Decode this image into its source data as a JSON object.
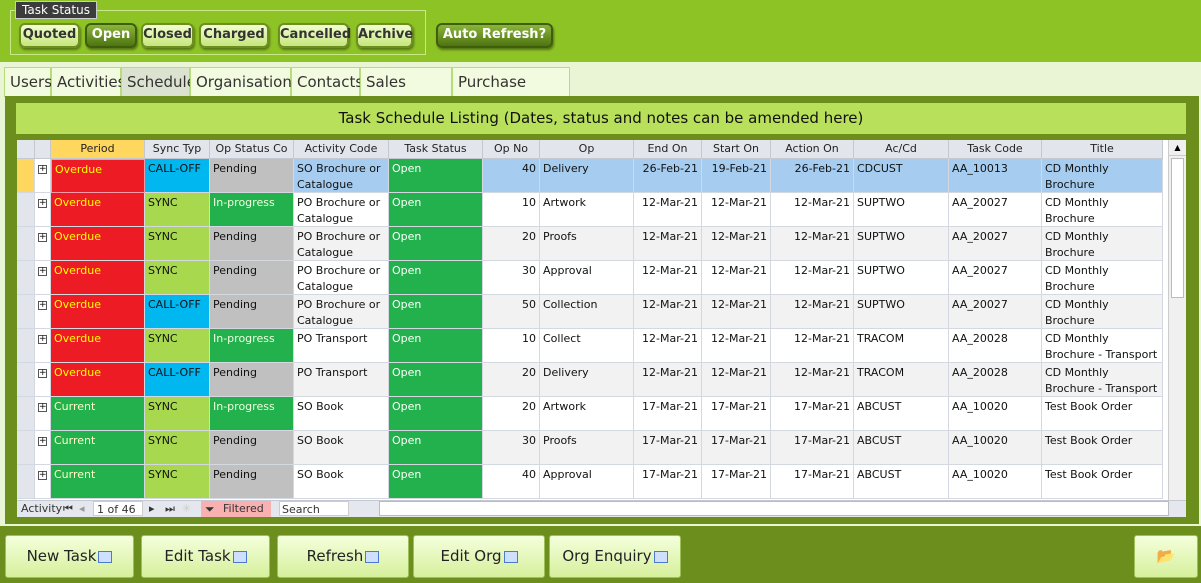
{
  "task_status": {
    "label": "Task Status",
    "buttons": [
      "Quoted",
      "Open",
      "Closed",
      "Charged",
      "Cancelled",
      "Archive"
    ],
    "active": "Open",
    "auto_refresh": "Auto Refresh?"
  },
  "tabs": [
    "Users",
    "Activities",
    "Schedule",
    "Organisations",
    "Contacts",
    "Sales Orders",
    "Purchase Orders"
  ],
  "active_tab": "Schedule",
  "banner": "Task Schedule Listing (Dates, status and notes can be amended here)",
  "columns": [
    "Period",
    "Sync Typ",
    "Op Status Co",
    "Activity Code",
    "Task Status",
    "Op No",
    "Op",
    "End On",
    "Start On",
    "Action On",
    "Ac/Cd",
    "Task Code",
    "Title"
  ],
  "rows": [
    [
      "Overdue",
      "CALL-OFF",
      "Pending",
      "SO Brochure or Catalogue",
      "Open",
      "40",
      "Delivery",
      "26-Feb-21",
      "19-Feb-21",
      "26-Feb-21",
      "CDCUST",
      "AA_10013",
      "CD Monthly Brochure"
    ],
    [
      "Overdue",
      "SYNC",
      "In-progress",
      "PO Brochure or Catalogue",
      "Open",
      "10",
      "Artwork",
      "12-Mar-21",
      "12-Mar-21",
      "12-Mar-21",
      "SUPTWO",
      "AA_20027",
      "CD Monthly Brochure"
    ],
    [
      "Overdue",
      "SYNC",
      "Pending",
      "PO Brochure or Catalogue",
      "Open",
      "20",
      "Proofs",
      "12-Mar-21",
      "12-Mar-21",
      "12-Mar-21",
      "SUPTWO",
      "AA_20027",
      "CD Monthly Brochure"
    ],
    [
      "Overdue",
      "SYNC",
      "Pending",
      "PO Brochure or Catalogue",
      "Open",
      "30",
      "Approval",
      "12-Mar-21",
      "12-Mar-21",
      "12-Mar-21",
      "SUPTWO",
      "AA_20027",
      "CD Monthly Brochure"
    ],
    [
      "Overdue",
      "CALL-OFF",
      "Pending",
      "PO Brochure or Catalogue",
      "Open",
      "50",
      "Collection",
      "12-Mar-21",
      "12-Mar-21",
      "12-Mar-21",
      "SUPTWO",
      "AA_20027",
      "CD Monthly Brochure"
    ],
    [
      "Overdue",
      "SYNC",
      "In-progress",
      "PO Transport",
      "Open",
      "10",
      "Collect",
      "12-Mar-21",
      "12-Mar-21",
      "12-Mar-21",
      "TRACOM",
      "AA_20028",
      "CD Monthly Brochure - Transport"
    ],
    [
      "Overdue",
      "CALL-OFF",
      "Pending",
      "PO Transport",
      "Open",
      "20",
      "Delivery",
      "12-Mar-21",
      "12-Mar-21",
      "12-Mar-21",
      "TRACOM",
      "AA_20028",
      "CD Monthly Brochure - Transport"
    ],
    [
      "Current",
      "SYNC",
      "In-progress",
      "SO Book",
      "Open",
      "20",
      "Artwork",
      "17-Mar-21",
      "17-Mar-21",
      "17-Mar-21",
      "ABCUST",
      "AA_10020",
      "Test Book Order"
    ],
    [
      "Current",
      "SYNC",
      "Pending",
      "SO Book",
      "Open",
      "30",
      "Proofs",
      "17-Mar-21",
      "17-Mar-21",
      "17-Mar-21",
      "ABCUST",
      "AA_10020",
      "Test Book Order"
    ],
    [
      "Current",
      "SYNC",
      "Pending",
      "SO Book",
      "Open",
      "40",
      "Approval",
      "17-Mar-21",
      "17-Mar-21",
      "17-Mar-21",
      "ABCUST",
      "AA_10020",
      "Test Book Order"
    ]
  ],
  "colors": {
    "Overdue": "#ed1c24",
    "Current": "#22b14c",
    "CALL-OFF": "#00b7ef",
    "SYNC": "#a8d84e",
    "Pending": "#c0c0c0",
    "In-progress": "#22b14c",
    "Open": "#22b14c",
    "selected": "#a6cdef"
  },
  "nav": {
    "label": "Activity",
    "record": "1 of 46",
    "filter": "Filtered",
    "search": "Search"
  },
  "bottom_buttons": [
    "New Task",
    "Edit Task",
    "Refresh",
    "Edit Org",
    "Org Enquiry"
  ],
  "folder_icon": "folder-open-icon"
}
